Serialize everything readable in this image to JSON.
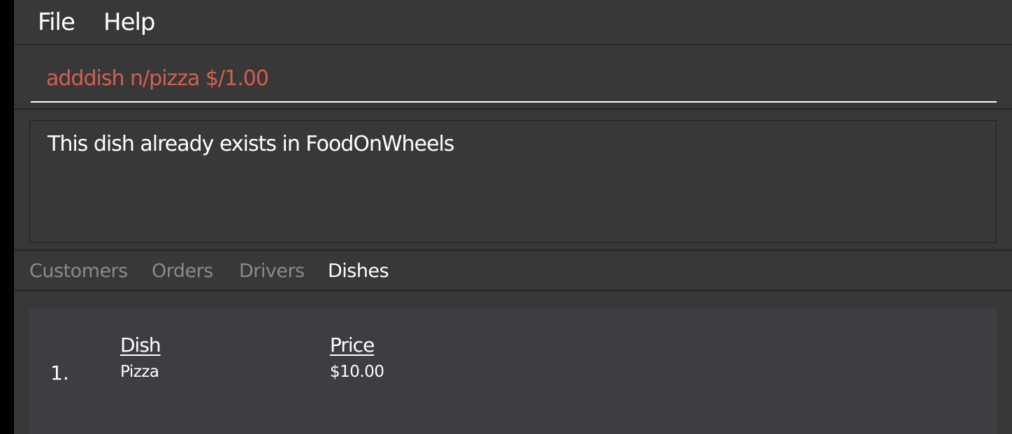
{
  "menu": {
    "file_label": "File",
    "help_label": "Help"
  },
  "command": {
    "value": "adddish n/pizza $/1.00",
    "error_color": "#d0614d"
  },
  "result": {
    "message": "This dish already exists in FoodOnWheels"
  },
  "tabs": [
    {
      "label": "Customers",
      "active": false
    },
    {
      "label": "Orders",
      "active": false
    },
    {
      "label": "Drivers",
      "active": false
    },
    {
      "label": "Dishes",
      "active": true
    }
  ],
  "dish_list": {
    "headers": {
      "dish": "Dish",
      "price": "Price"
    },
    "items": [
      {
        "index": "1.",
        "dish": "Pizza",
        "price": "$10.00"
      }
    ]
  }
}
